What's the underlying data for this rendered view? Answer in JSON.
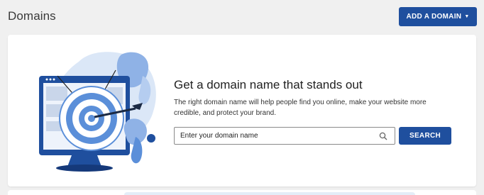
{
  "header": {
    "title": "Domains",
    "add_domain_label": "ADD A DOMAIN"
  },
  "promo": {
    "headline": "Get a domain name that stands out",
    "description": "The right domain name will help people find you online, make your website more credible, and protect your brand.",
    "search": {
      "value": "",
      "placeholder": "Enter your domain name",
      "button_label": "SEARCH"
    }
  },
  "colors": {
    "primary": "#1f4f9e",
    "page_bg": "#f0f0f0",
    "card_bg": "#ffffff",
    "illustration_blue": "#5b8fd9",
    "illustration_light": "#dbe7f7"
  },
  "icons": {
    "search": "magnifier-icon",
    "dropdown": "caret-down-icon"
  }
}
